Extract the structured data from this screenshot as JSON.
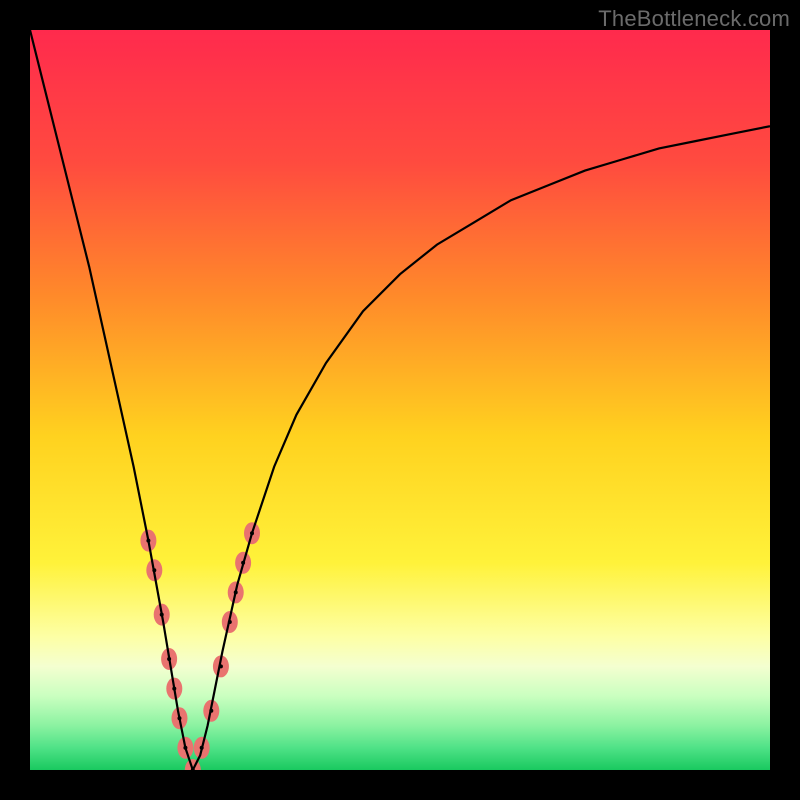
{
  "watermark": "TheBottleneck.com",
  "chart_data": {
    "type": "line",
    "title": "",
    "xlabel": "",
    "ylabel": "",
    "xlim": [
      0,
      100
    ],
    "ylim": [
      0,
      100
    ],
    "grid": false,
    "legend": false,
    "description": "V-shaped bottleneck curve on a vertical red-to-green gradient. Minimum (0%) occurs near x ≈ 22. Pink bead markers cluster on the lower arms of the V near the bottom.",
    "gradient_stops": [
      {
        "pos": 0.0,
        "color": "#ff2a4d"
      },
      {
        "pos": 0.18,
        "color": "#ff4b3f"
      },
      {
        "pos": 0.36,
        "color": "#ff8a2a"
      },
      {
        "pos": 0.55,
        "color": "#ffd21f"
      },
      {
        "pos": 0.72,
        "color": "#fff23a"
      },
      {
        "pos": 0.82,
        "color": "#fdffa5"
      },
      {
        "pos": 0.86,
        "color": "#f4ffd0"
      },
      {
        "pos": 0.9,
        "color": "#caffc0"
      },
      {
        "pos": 0.94,
        "color": "#8bf2a1"
      },
      {
        "pos": 0.97,
        "color": "#4fe287"
      },
      {
        "pos": 1.0,
        "color": "#19c95f"
      }
    ],
    "series": [
      {
        "name": "bottleneck-curve",
        "color": "#000000",
        "x": [
          0,
          2,
          4,
          6,
          8,
          10,
          12,
          14,
          16,
          18,
          19,
          20,
          21,
          22,
          23,
          24,
          25,
          26,
          28,
          30,
          33,
          36,
          40,
          45,
          50,
          55,
          60,
          65,
          70,
          75,
          80,
          85,
          90,
          95,
          100
        ],
        "y": [
          100,
          92,
          84,
          76,
          68,
          59,
          50,
          41,
          31,
          20,
          14,
          8,
          3,
          0,
          2,
          6,
          11,
          16,
          25,
          32,
          41,
          48,
          55,
          62,
          67,
          71,
          74,
          77,
          79,
          81,
          82.5,
          84,
          85,
          86,
          87
        ]
      }
    ],
    "markers": {
      "name": "bead-markers",
      "color": "#e9736f",
      "points": [
        {
          "x": 16.0,
          "y": 31
        },
        {
          "x": 16.8,
          "y": 27
        },
        {
          "x": 17.8,
          "y": 21
        },
        {
          "x": 18.8,
          "y": 15
        },
        {
          "x": 19.5,
          "y": 11
        },
        {
          "x": 20.2,
          "y": 7
        },
        {
          "x": 21.0,
          "y": 3
        },
        {
          "x": 22.0,
          "y": 0
        },
        {
          "x": 23.2,
          "y": 3
        },
        {
          "x": 24.5,
          "y": 8
        },
        {
          "x": 25.8,
          "y": 14
        },
        {
          "x": 27.0,
          "y": 20
        },
        {
          "x": 27.8,
          "y": 24
        },
        {
          "x": 28.8,
          "y": 28
        },
        {
          "x": 30.0,
          "y": 32
        }
      ]
    }
  }
}
